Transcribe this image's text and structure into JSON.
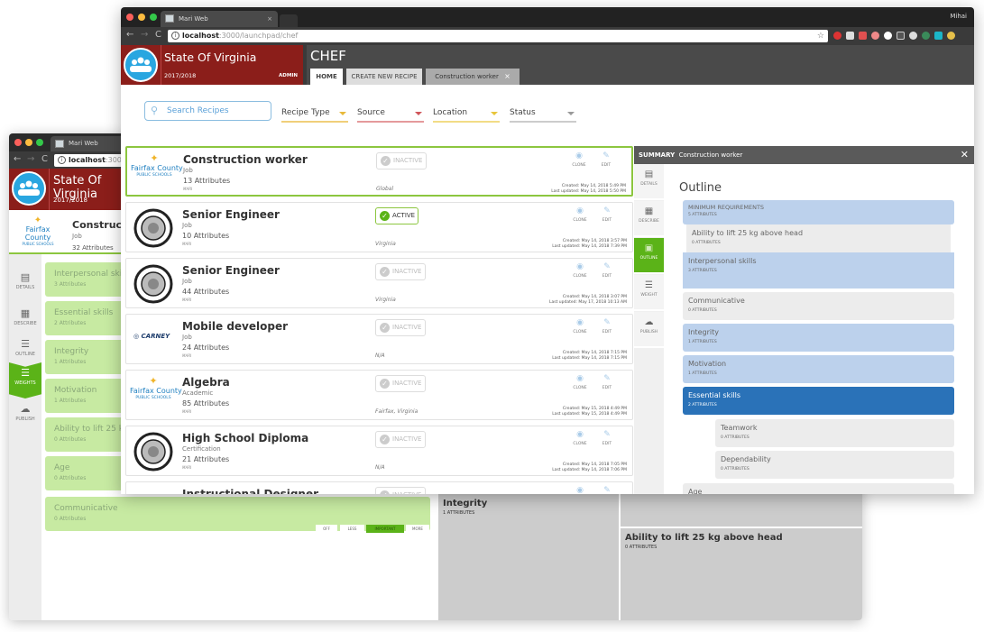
{
  "back_window": {
    "tab_title": "Mari Web",
    "url_host": "localhost",
    "url_rest": ":3000/",
    "org_name": "State Of Virginia",
    "year": "2017/2018",
    "recipe": {
      "name": "Construction worker",
      "type": "Job",
      "attributes": "32 Attributes"
    },
    "side_nav": [
      {
        "label": "DETAILS",
        "icon": "document-icon"
      },
      {
        "label": "DESCRIBE",
        "icon": "clipboard-icon"
      },
      {
        "label": "OUTLINE",
        "icon": "outline-icon"
      },
      {
        "label": "WEIGHTS",
        "icon": "sliders-icon",
        "active": true
      },
      {
        "label": "PUBLISH",
        "icon": "cloud-upload-icon"
      }
    ],
    "weight_items": [
      {
        "title": "Interpersonal skills",
        "sub": "3 Attributes"
      },
      {
        "title": "Essential skills",
        "sub": "2 Attributes"
      },
      {
        "title": "Integrity",
        "sub": "1 Attributes"
      },
      {
        "title": "Motivation",
        "sub": "1 Attributes"
      },
      {
        "title": "Ability to lift 25 kg above head",
        "sub": "0 Attributes"
      },
      {
        "title": "Age",
        "sub": "0 Attributes"
      },
      {
        "title": "Communicative",
        "sub": "0 Attributes"
      }
    ],
    "weight_options": [
      "OFF",
      "LESS",
      "IMPORTANT",
      "MORE"
    ],
    "weight_selected": "IMPORTANT",
    "treemap": [
      {
        "title": "Integrity",
        "sub": "1 ATTRIBUTES"
      },
      {
        "title": "",
        "sub": ""
      },
      {
        "title": "Ability to lift 25 kg above head",
        "sub": "0 ATTRIBUTES"
      }
    ]
  },
  "front_window": {
    "tab_title": "Mari Web",
    "url_host": "localhost",
    "url_rest": ":3000/launchpad/chef",
    "profile_name": "Mihai",
    "org_name": "State Of Virginia",
    "year": "2017/2018",
    "role": "ADMIN",
    "app_title": "CHEF",
    "tabs": [
      {
        "label": "HOME",
        "active": true
      },
      {
        "label": "CREATE NEW RECIPE"
      },
      {
        "label": "Construction worker",
        "closable": true
      }
    ],
    "search_placeholder": "Search Recipes",
    "filters": [
      {
        "label": "Recipe Type",
        "color": "#e8b93a"
      },
      {
        "label": "Source",
        "color": "#d0555a"
      },
      {
        "label": "Location",
        "color": "#e8c53a"
      },
      {
        "label": "Status",
        "color": "#999999"
      }
    ],
    "recipes": [
      {
        "name": "Construction worker",
        "type": "Job",
        "attributes": "13 Attributes",
        "source": "MARI",
        "status": "INACTIVE",
        "location": "Global",
        "created": "Created: May 14, 2018 5:49 PM",
        "updated": "Last updated: May 14, 2018 5:50 PM",
        "logo": "fairfax",
        "selected": true
      },
      {
        "name": "Senior Engineer",
        "type": "Job",
        "attributes": "10 Attributes",
        "source": "MARI",
        "status": "ACTIVE",
        "location": "Virginia",
        "created": "Created: May 14, 2018 3:57 PM",
        "updated": "Last updated: May 14, 2018 7:39 PM",
        "logo": "seal"
      },
      {
        "name": "Senior Engineer",
        "type": "Job",
        "attributes": "44 Attributes",
        "source": "MARI",
        "status": "INACTIVE",
        "location": "Virginia",
        "created": "Created: May 14, 2018 3:07 PM",
        "updated": "Last updated: May 17, 2018 10:13 AM",
        "logo": "seal"
      },
      {
        "name": "Mobile developer",
        "type": "Job",
        "attributes": "24 Attributes",
        "source": "MARI",
        "status": "INACTIVE",
        "location": "N/A",
        "created": "Created: May 14, 2018 7:15 PM",
        "updated": "Last updated: May 14, 2018 7:15 PM",
        "logo": "carney"
      },
      {
        "name": "Algebra",
        "type": "Academic",
        "attributes": "85 Attributes",
        "source": "MARI",
        "status": "INACTIVE",
        "location": "Fairfax, Virginia",
        "created": "Created: May 15, 2018 4:49 PM",
        "updated": "Last updated: May 15, 2018 4:49 PM",
        "logo": "fairfax"
      },
      {
        "name": "High School Diploma",
        "type": "Certification",
        "attributes": "21 Attributes",
        "source": "MARI",
        "status": "INACTIVE",
        "location": "N/A",
        "created": "Created: May 14, 2018 7:05 PM",
        "updated": "Last updated: May 14, 2018 7:06 PM",
        "logo": "seal"
      },
      {
        "name": "Instructional Designer",
        "type": "",
        "attributes": "",
        "source": "",
        "status": "INACTIVE",
        "location": "",
        "created": "",
        "updated": "",
        "logo": ""
      }
    ],
    "clone_label": "CLONE",
    "edit_label": "EDIT",
    "logo_texts": {
      "fairfax_main": "Fairfax County",
      "fairfax_sub": "PUBLIC SCHOOLS",
      "carney": "CARNEY"
    },
    "summary": {
      "label": "SUMMARY",
      "recipe": "Construction worker",
      "side_nav": [
        {
          "label": "DETAILS",
          "icon": "document-icon"
        },
        {
          "label": "DESCRIBE",
          "icon": "clipboard-icon"
        },
        {
          "label": "OUTLINE",
          "icon": "outline-icon",
          "active": true
        },
        {
          "label": "WEIGHT",
          "icon": "sliders-icon"
        },
        {
          "label": "PUBLISH",
          "icon": "cloud-upload-icon"
        }
      ],
      "outline_title": "Outline",
      "outline": [
        {
          "title": "MINIMUM REQUIREMENTS",
          "sub": "5 ATTRIBUTES",
          "style": "blue",
          "level": 0
        },
        {
          "title": "Ability to lift 25 kg above head",
          "sub": "0 ATTRIBUTES",
          "style": "gray",
          "level": 0
        },
        {
          "title": "Interpersonal skills",
          "sub": "3 ATTRIBUTES",
          "style": "blue",
          "level": 0
        },
        {
          "title": "Communicative",
          "sub": "0 ATTRIBUTES",
          "style": "gray",
          "level": 0
        },
        {
          "title": "Integrity",
          "sub": "1 ATTRIBUTES",
          "style": "blue",
          "level": 0
        },
        {
          "title": "Motivation",
          "sub": "1 ATTRIBUTES",
          "style": "blue",
          "level": 0
        },
        {
          "title": "Essential skills",
          "sub": "2 ATTRIBUTES",
          "style": "dark",
          "level": 0
        },
        {
          "title": "Teamwork",
          "sub": "0 ATTRIBUTES",
          "style": "gray",
          "level": 1
        },
        {
          "title": "Dependability",
          "sub": "0 ATTRIBUTES",
          "style": "gray",
          "level": 1
        },
        {
          "title": "Age",
          "sub": "",
          "style": "gray",
          "level": 0
        }
      ]
    }
  }
}
